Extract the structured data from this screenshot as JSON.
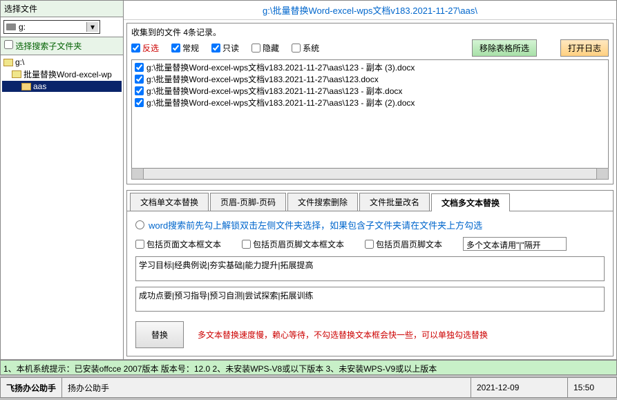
{
  "left": {
    "header": "选择文件",
    "drive": "g:",
    "subfolder_label": "选择搜索子文件夹",
    "tree": [
      {
        "label": "g:\\",
        "indent": 0,
        "selected": false
      },
      {
        "label": "批量替换Word-excel-wp",
        "indent": 1,
        "selected": false
      },
      {
        "label": "aas",
        "indent": 2,
        "selected": true
      }
    ]
  },
  "path": "g:\\批量替换Word-excel-wps文档v183.2021-11-27\\aas\\",
  "collect": {
    "title": "收集到的文件 4条记录。",
    "filters": {
      "invert": "反选",
      "normal": "常规",
      "readonly": "只读",
      "hidden": "隐藏",
      "system": "系统"
    },
    "remove_btn": "移除表格所选",
    "openlog_btn": "打开日志",
    "files": [
      "g:\\批量替换Word-excel-wps文档v183.2021-11-27\\aas\\123 - 副本 (3).docx",
      "g:\\批量替换Word-excel-wps文档v183.2021-11-27\\aas\\123.docx",
      "g:\\批量替换Word-excel-wps文档v183.2021-11-27\\aas\\123 - 副本.docx",
      "g:\\批量替换Word-excel-wps文档v183.2021-11-27\\aas\\123 - 副本 (2).docx"
    ]
  },
  "tabs": {
    "t1": "文档单文本替换",
    "t2": "页眉-页脚-页码",
    "t3": "文件搜索删除",
    "t4": "文件批量改名",
    "t5": "文档多文本替换"
  },
  "content": {
    "radio_label": "word搜索前先勾上解锁双击左侧文件夹选择，如果包含子文件夹请在文件夹上方勾选",
    "include_page": "包括页面文本框文本",
    "include_hf_box": "包括页眉页脚文本框文本",
    "include_hf": "包括页眉页脚文本",
    "hint": "多个文本请用\"|\"隔开",
    "ta1": "学习目标|经典例说|夯实基础|能力提升|拓展提高",
    "ta2": "成功点要|预习指导|预习自测|尝试探索|拓展训练",
    "replace_btn": "替换",
    "warn": "多文本替换速度慢，赖心等待，不勾选替换文本框会快一些，可以单独勾选替换"
  },
  "status": "1、本机系统提示：已安装offcce 2007版本 版本号：12.0  2、未安装WPS-V8或以下版本  3、未安装WPS-V9或以上版本",
  "bottom": {
    "title": "飞扬办公助手",
    "sub": "扬办公助手",
    "date": "2021-12-09",
    "time": "15:50"
  }
}
